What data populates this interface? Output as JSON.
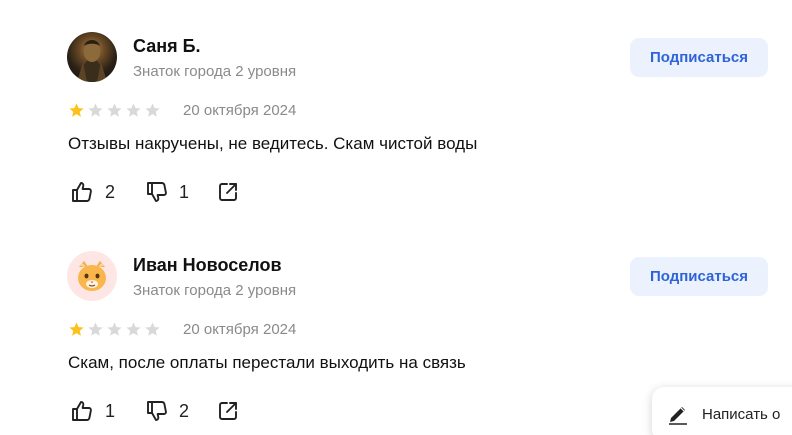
{
  "reviews": [
    {
      "author": "Саня Б.",
      "level": "Знаток города 2 уровня",
      "subscribe_label": "Подписаться",
      "rating": 1,
      "max_rating": 5,
      "date": "20 октября 2024",
      "text": "Отзывы накручены, не ведитесь. Скам чистой воды",
      "likes": "2",
      "dislikes": "1",
      "avatar_icon": "user-photo"
    },
    {
      "author": "Иван Новоселов",
      "level": "Знаток города 2 уровня",
      "subscribe_label": "Подписаться",
      "rating": 1,
      "max_rating": 5,
      "date": "20 октября 2024",
      "text": "Скам, после оплаты перестали выходить на связь",
      "likes": "1",
      "dislikes": "2",
      "avatar_icon": "cat-emoji"
    }
  ],
  "write_review_label": "Написать о",
  "colors": {
    "star_filled": "#fcc21b",
    "star_empty": "#d9d9d9",
    "subscribe_bg": "#ebf2fe",
    "subscribe_text": "#2e64d8",
    "muted_text": "#8a8a8a"
  }
}
